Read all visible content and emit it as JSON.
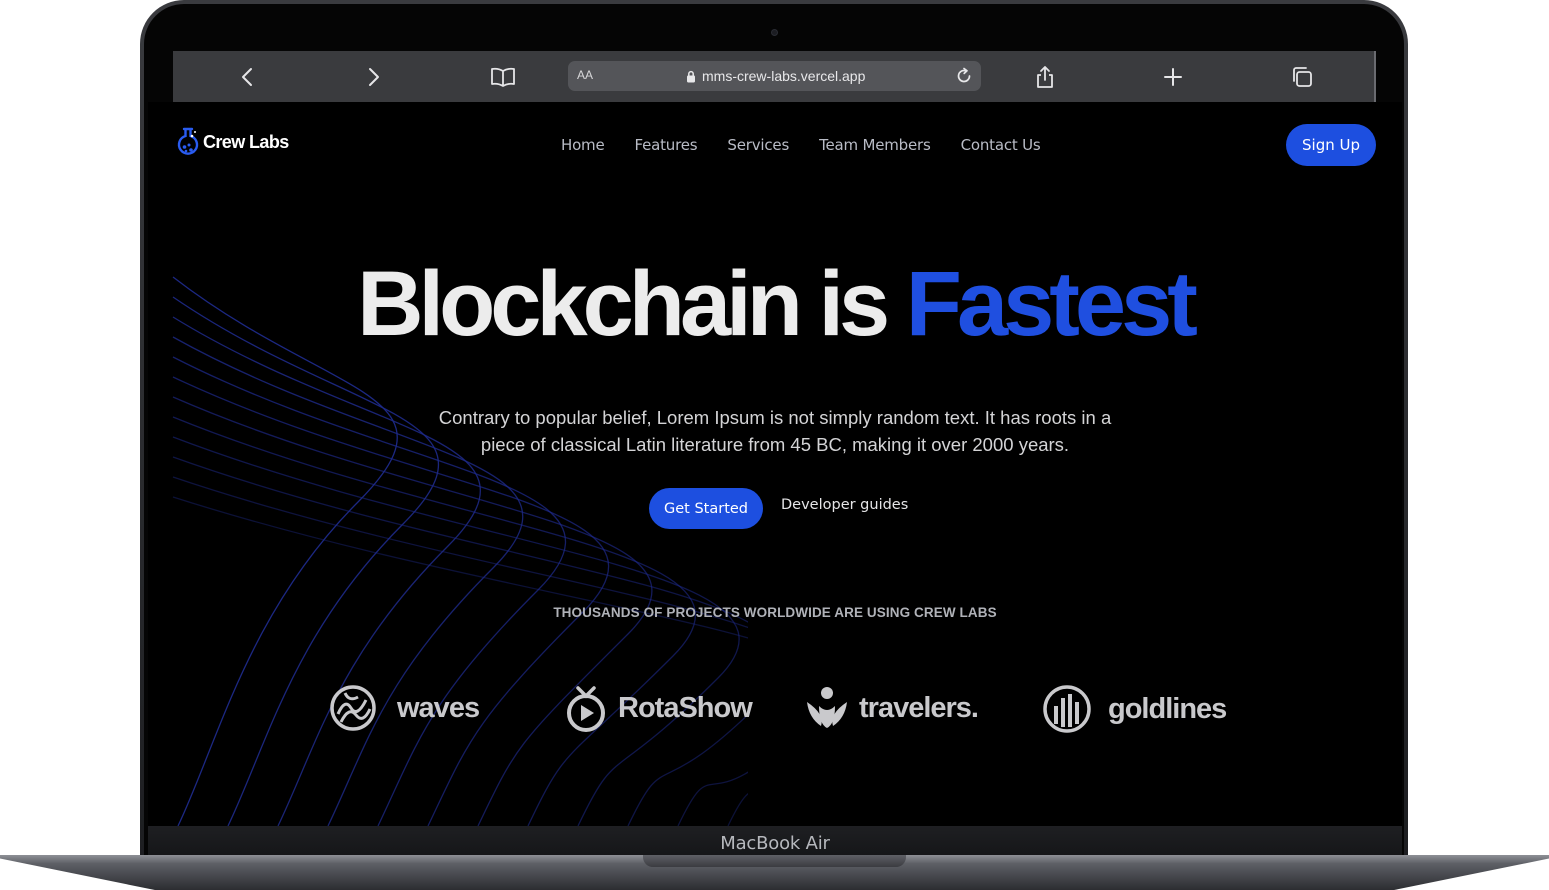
{
  "device": {
    "label": "MacBook Air"
  },
  "browser": {
    "url": "mms-crew-labs.vercel.app",
    "text_size_button": "AA",
    "icons": [
      "back-icon",
      "forward-icon",
      "bookmarks-icon",
      "lock-icon",
      "reload-icon",
      "share-icon",
      "new-tab-icon",
      "tabs-icon"
    ]
  },
  "site": {
    "logo_text": "Crew Labs",
    "nav": [
      {
        "label": "Home"
      },
      {
        "label": "Features"
      },
      {
        "label": "Services"
      },
      {
        "label": "Team Members"
      },
      {
        "label": "Contact Us"
      }
    ],
    "signup_label": "Sign Up"
  },
  "hero": {
    "title_main": "Blockchain is",
    "title_accent": "Fastest",
    "description": "Contrary to popular belief, Lorem Ipsum is not simply random text. It has roots in a piece of classical Latin literature from 45 BC, making it over 2000 years.",
    "primary_cta": "Get Started",
    "secondary_cta": "Developer guides"
  },
  "trust": {
    "caption": "THOUSANDS OF PROJECTS WORLDWIDE ARE USING CREW LABS",
    "brands": [
      {
        "name": "waves",
        "icon": "waves-logo-icon"
      },
      {
        "name": "RotaShow",
        "icon": "rotashow-logo-icon"
      },
      {
        "name": "travelers.",
        "icon": "travelers-logo-icon"
      },
      {
        "name": "goldlines",
        "icon": "goldlines-logo-icon"
      }
    ]
  },
  "colors": {
    "accent": "#1d4fe0",
    "background": "#000000",
    "toolbar": "#3a3b3e",
    "wave_lines": "#1e2a8a"
  }
}
